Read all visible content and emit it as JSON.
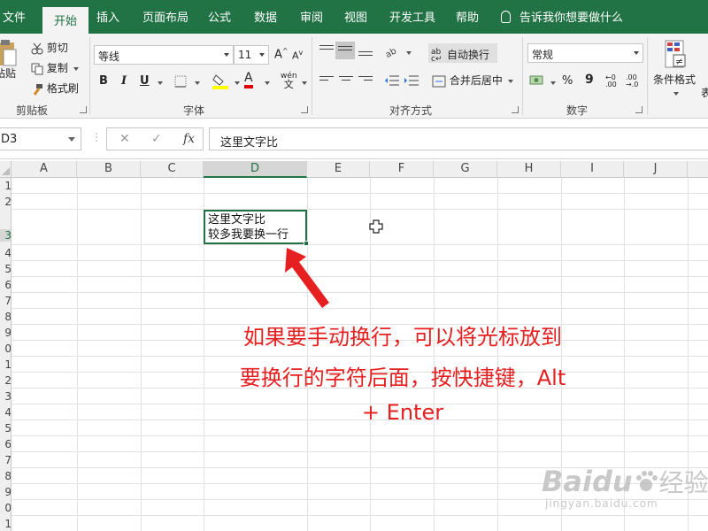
{
  "tabs": [
    "文件",
    "开始",
    "插入",
    "页面布局",
    "公式",
    "数据",
    "审阅",
    "视图",
    "开发工具",
    "帮助"
  ],
  "tell_me": "告诉我你想要做什么",
  "clipboard": {
    "paste": "粘贴",
    "cut": "剪切",
    "copy": "复制",
    "format_painter": "格式刷",
    "group": "剪贴板"
  },
  "font": {
    "name": "等线",
    "size": "11",
    "bold": "B",
    "italic": "I",
    "underline": "U",
    "grow": "A",
    "shrink": "A",
    "color_letter": "A",
    "phonetic": "wén",
    "phonetic_char": "文",
    "group": "字体"
  },
  "alignment": {
    "wrap_text": "自动换行",
    "merge_center": "合并后居中",
    "group": "对齐方式"
  },
  "number": {
    "format": "常规",
    "percent": "%",
    "comma": "9",
    "group": "数字"
  },
  "styles": {
    "conditional": "条件格式",
    "table_partial": "表"
  },
  "name_box": "D3",
  "formula_icons": {
    "cancel": "✕",
    "enter": "✓",
    "fx": "fx"
  },
  "formula_text": "这里文字比",
  "columns": [
    "A",
    "B",
    "C",
    "D",
    "E",
    "F",
    "G",
    "H",
    "I",
    "J"
  ],
  "rows": [
    "1",
    "2",
    "3",
    "4",
    "5",
    "6",
    "7",
    "8",
    "9",
    "0",
    "1",
    "2",
    "3",
    "4",
    "5",
    "6",
    "7",
    "8",
    "9",
    "0",
    "1",
    "2"
  ],
  "cell_lines": [
    "这里文字比",
    "较多我要换一行"
  ],
  "annotation_lines": [
    "如果要手动换行，可以将光标放到",
    "要换行的字符后面，按快捷键，Alt",
    "+ Enter"
  ],
  "watermark": {
    "brand": "Baidu",
    "cn": "经验",
    "url": "jingyan.baidu.com"
  },
  "colors": {
    "accent": "#217346",
    "annotation": "#e62020"
  }
}
